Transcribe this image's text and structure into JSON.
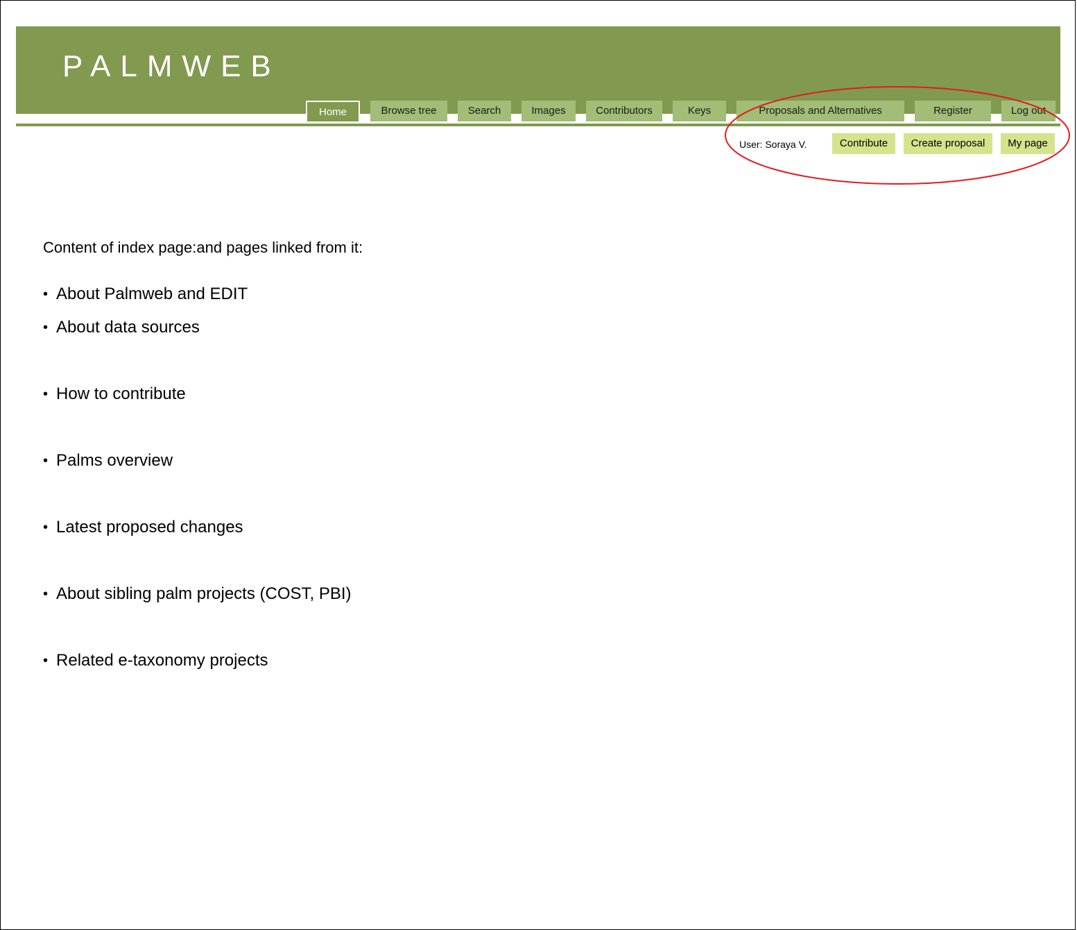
{
  "site": {
    "title": "PALMWEB"
  },
  "nav": {
    "tabs": [
      {
        "label": "Home",
        "active": true
      },
      {
        "label": "Browse tree"
      },
      {
        "label": "Search"
      },
      {
        "label": "Images"
      },
      {
        "label": "Contributors"
      },
      {
        "label": "Keys"
      },
      {
        "label": "Proposals and Alternatives"
      },
      {
        "label": "Register"
      },
      {
        "label": "Log out"
      }
    ]
  },
  "user_bar": {
    "user_label": "User: Soraya V.",
    "contribute": "Contribute",
    "create_proposal": "Create proposal",
    "my_page": "My page"
  },
  "content": {
    "intro_a": "Content of index page",
    "intro_b": ":and pages linked from it:",
    "items": [
      "About Palmweb and EDIT",
      "About data sources",
      "How to contribute",
      "Palms overview",
      "Latest proposed changes",
      "About sibling palm projects (COST, PBI)",
      "Related e-taxonomy projects"
    ]
  },
  "colors": {
    "header_green": "#819a4f",
    "tab_green": "#a2bd77",
    "user_button": "#d5e38c",
    "annotation_red": "#e41a1c"
  }
}
